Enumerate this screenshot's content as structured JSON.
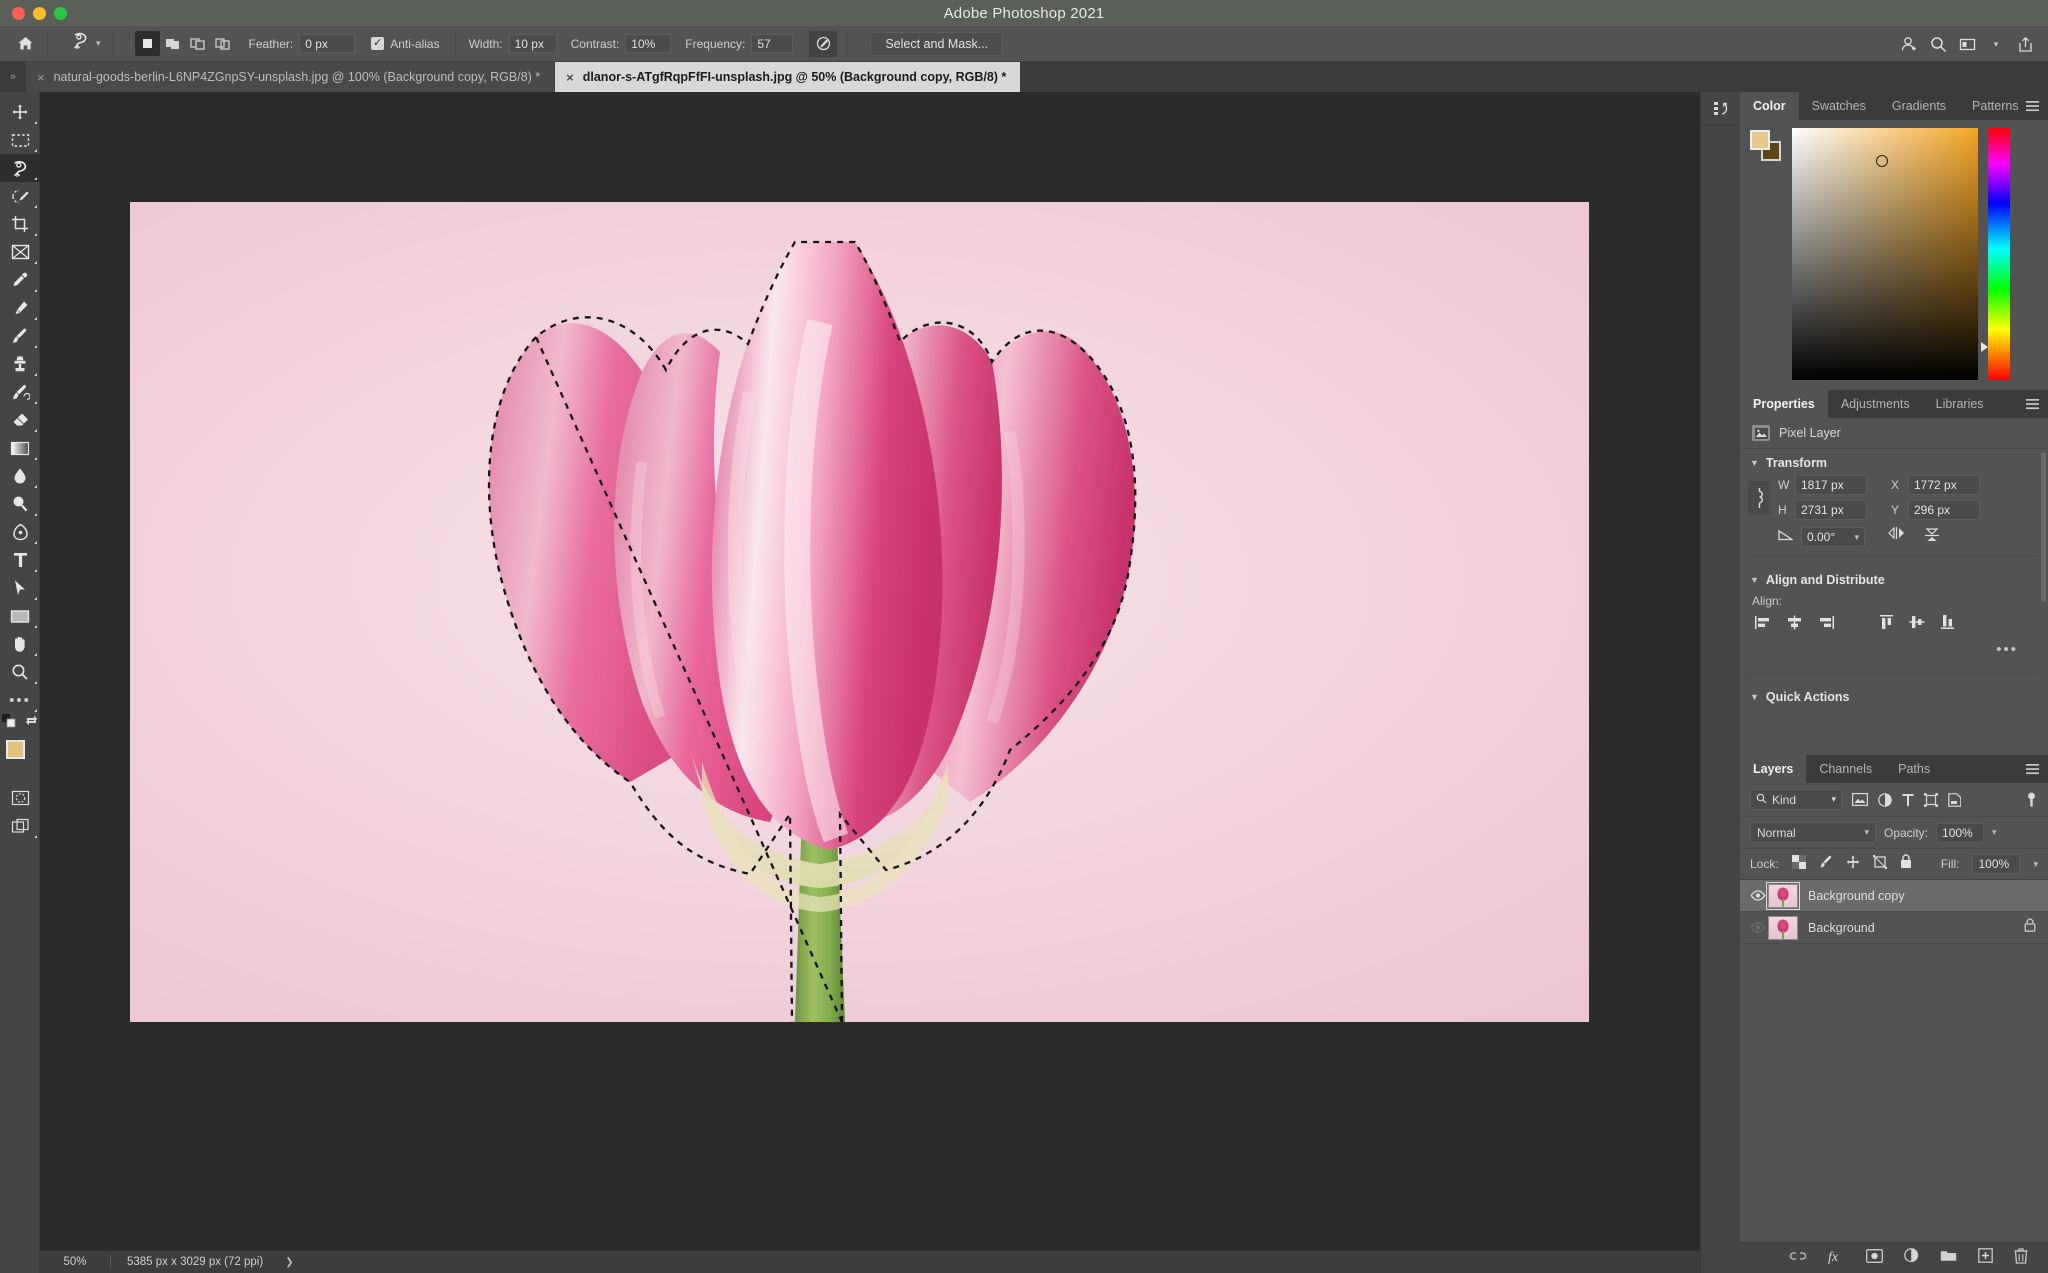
{
  "window": {
    "title": "Adobe Photoshop 2021",
    "traffic_lights": [
      "close",
      "minimize",
      "maximize"
    ]
  },
  "options_bar": {
    "home_icon": "home-icon",
    "tool_icon": "magnetic-lasso-icon",
    "tool_preset_chevron": "chevron-down-icon",
    "selection_modes": [
      {
        "name": "new-selection",
        "active": true
      },
      {
        "name": "add-to-selection",
        "active": false
      },
      {
        "name": "subtract-from-selection",
        "active": false
      },
      {
        "name": "intersect-with-selection",
        "active": false
      }
    ],
    "feather_label": "Feather:",
    "feather_value": "0 px",
    "antialias_label": "Anti-alias",
    "antialias_checked": true,
    "width_label": "Width:",
    "width_value": "10 px",
    "contrast_label": "Contrast:",
    "contrast_value": "10%",
    "frequency_label": "Frequency:",
    "frequency_value": "57",
    "pen_pressure_icon": "pen-pressure-icon",
    "select_and_mask_label": "Select and Mask...",
    "right_icons": [
      "add-user-icon",
      "search-icon",
      "workspace-icon",
      "chevron-down-icon",
      "share-icon"
    ]
  },
  "tabs": {
    "overflow_icon": "chevron-double-right-icon",
    "items": [
      {
        "label": "natural-goods-berlin-L6NP4ZGnpSY-unsplash.jpg @ 100% (Background copy, RGB/8) *",
        "active": false,
        "close_icon": "close-icon"
      },
      {
        "label": "dlanor-s-ATgfRqpFfFI-unsplash.jpg @ 50% (Background copy, RGB/8) *",
        "active": true,
        "close_icon": "close-icon"
      }
    ]
  },
  "toolbar": {
    "tools": [
      {
        "name": "move-tool",
        "active": false
      },
      {
        "name": "rectangular-marquee-tool",
        "active": false
      },
      {
        "name": "magnetic-lasso-tool",
        "active": true
      },
      {
        "name": "object-selection-tool",
        "active": false
      },
      {
        "name": "crop-tool",
        "active": false
      },
      {
        "name": "frame-tool",
        "active": false
      },
      {
        "name": "eyedropper-tool",
        "active": false
      },
      {
        "name": "spot-healing-brush-tool",
        "active": false
      },
      {
        "name": "brush-tool",
        "active": false
      },
      {
        "name": "clone-stamp-tool",
        "active": false
      },
      {
        "name": "history-brush-tool",
        "active": false
      },
      {
        "name": "eraser-tool",
        "active": false
      },
      {
        "name": "gradient-tool",
        "active": false
      },
      {
        "name": "blur-tool",
        "active": false
      },
      {
        "name": "dodge-tool",
        "active": false
      },
      {
        "name": "pen-tool",
        "active": false
      },
      {
        "name": "type-tool",
        "active": false
      },
      {
        "name": "path-selection-tool",
        "active": false
      },
      {
        "name": "rectangle-tool",
        "active": false
      },
      {
        "name": "hand-tool",
        "active": false
      },
      {
        "name": "zoom-tool",
        "active": false
      },
      {
        "name": "edit-toolbar-tool",
        "active": false
      }
    ],
    "foreground_color": "#e3c178",
    "background_color": "#6b4c18",
    "quick_mask_icon": "quick-mask-icon",
    "screen_mode_icon": "screen-mode-icon"
  },
  "canvas": {
    "artboard_bg": "#f2d4de",
    "selection_active": true,
    "flower_color": "#d8447f",
    "stem_color": "#7fa94a"
  },
  "status_bar": {
    "zoom": "50%",
    "doc_size": "5385 px x 3029 px (72 ppi)",
    "expand_icon": "chevron-right-icon"
  },
  "rail": {
    "icons": [
      "history-panel-icon"
    ]
  },
  "color_panel": {
    "tabs": [
      {
        "label": "Color",
        "active": true
      },
      {
        "label": "Swatches",
        "active": false
      },
      {
        "label": "Gradients",
        "active": false
      },
      {
        "label": "Patterns",
        "active": false
      }
    ],
    "menu_icon": "panel-menu-icon",
    "foreground_color": "#e8c98a",
    "background_color": "#5e4514",
    "spectrum_hue": "#f5a623",
    "marker_icon": "color-marker-icon"
  },
  "properties_panel": {
    "tabs": [
      {
        "label": "Properties",
        "active": true
      },
      {
        "label": "Adjustments",
        "active": false
      },
      {
        "label": "Libraries",
        "active": false
      }
    ],
    "menu_icon": "panel-menu-icon",
    "layer_type_icon": "pixel-layer-icon",
    "layer_type_label": "Pixel Layer",
    "transform": {
      "title": "Transform",
      "collapse_icon": "chevron-down-icon",
      "link_icon": "link-dimensions-icon",
      "w_label": "W",
      "w_value": "1817 px",
      "x_label": "X",
      "x_value": "1772 px",
      "h_label": "H",
      "h_value": "2731 px",
      "y_label": "Y",
      "y_value": "296 px",
      "angle_icon": "angle-icon",
      "angle_value": "0.00°",
      "angle_chevron": "chevron-down-icon",
      "flip_horizontal_icon": "flip-horizontal-icon",
      "flip_vertical_icon": "flip-vertical-icon"
    },
    "align": {
      "title": "Align and Distribute",
      "collapse_icon": "chevron-down-icon",
      "label": "Align:",
      "icons": [
        "align-left-edges-icon",
        "align-horizontal-centers-icon",
        "align-right-edges-icon",
        "align-top-edges-icon",
        "align-vertical-centers-icon",
        "align-bottom-edges-icon"
      ],
      "more_icon": "more-options-icon"
    },
    "quick_actions": {
      "title": "Quick Actions",
      "collapse_icon": "chevron-down-icon"
    }
  },
  "layers_panel": {
    "tabs": [
      {
        "label": "Layers",
        "active": true
      },
      {
        "label": "Channels",
        "active": false
      },
      {
        "label": "Paths",
        "active": false
      }
    ],
    "menu_icon": "panel-menu-icon",
    "filter": {
      "search_icon": "search-icon",
      "kind_label": "Kind",
      "chevron_icon": "chevron-down-icon",
      "filter_icons": [
        "filter-pixel-icon",
        "filter-adjustment-icon",
        "filter-type-icon",
        "filter-shape-icon",
        "filter-smart-object-icon"
      ],
      "toggle_icon": "filter-toggle-icon"
    },
    "blend_mode": "Normal",
    "blend_chevron": "chevron-down-icon",
    "opacity_label": "Opacity:",
    "opacity_value": "100%",
    "opacity_chevron": "chevron-down-icon",
    "lock_label": "Lock:",
    "lock_icons": [
      "lock-transparent-pixels-icon",
      "lock-image-pixels-icon",
      "lock-position-icon",
      "lock-artboard-nesting-icon",
      "lock-all-icon"
    ],
    "fill_label": "Fill:",
    "fill_value": "100%",
    "fill_chevron": "chevron-down-icon",
    "layers": [
      {
        "name": "Background copy",
        "visible": true,
        "selected": true,
        "locked": false,
        "eye_icon": "eye-icon",
        "thumbnail": "layer-thumbnail"
      },
      {
        "name": "Background",
        "visible": false,
        "selected": false,
        "locked": true,
        "eye_icon": "eye-icon",
        "lock_icon": "lock-icon",
        "thumbnail": "layer-thumbnail"
      }
    ],
    "footer_icons": [
      "link-layers-icon",
      "layer-style-fx-icon",
      "add-layer-mask-icon",
      "new-adjustment-layer-icon",
      "new-group-icon",
      "new-layer-icon",
      "delete-layer-icon"
    ]
  }
}
